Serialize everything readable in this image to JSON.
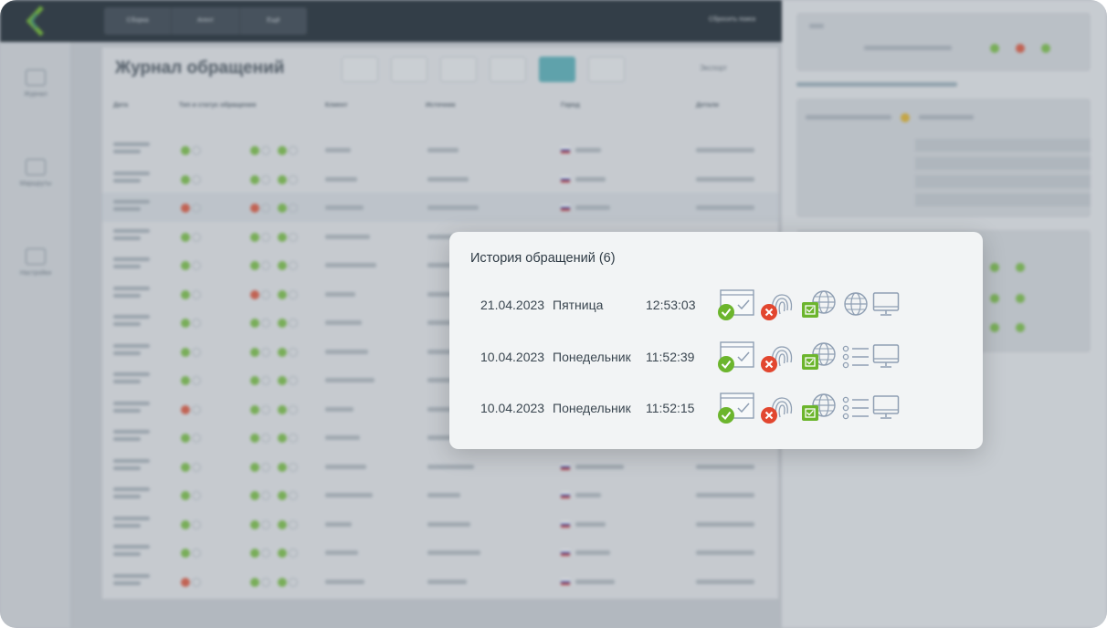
{
  "app": {
    "top_segments": [
      "Сборка",
      "Агент",
      "Ещё"
    ],
    "user": "Сбросить поиск",
    "sidebar": [
      {
        "label": "Журнал",
        "icon": "journal-icon"
      },
      {
        "label": "Маршруты",
        "icon": "routes-icon"
      },
      {
        "label": "Настройки",
        "icon": "settings-icon"
      }
    ],
    "page_title": "Журнал обращений",
    "export_label": "Экспорт",
    "columns": [
      "Дата",
      "Тип и статус обращения",
      "Клиент",
      "Источник",
      "Город",
      "Детали"
    ]
  },
  "modal": {
    "title": "История обращений (6)",
    "rows": [
      {
        "date": "21.04.2023",
        "day": "Пятница",
        "time": "12:53:03",
        "form_status": "success",
        "fingerprint_status": "error",
        "network_status": "success",
        "extra_icon": "globe-icon",
        "device_icon": "monitor-icon"
      },
      {
        "date": "10.04.2023",
        "day": "Понедельник",
        "time": "11:52:39",
        "form_status": "success",
        "fingerprint_status": "error",
        "network_status": "success",
        "extra_icon": "list-icon",
        "device_icon": "monitor-icon"
      },
      {
        "date": "10.04.2023",
        "day": "Понедельник",
        "time": "11:52:15",
        "form_status": "success",
        "fingerprint_status": "error",
        "network_status": "success",
        "extra_icon": "list-icon",
        "device_icon": "monitor-icon"
      }
    ]
  },
  "colors": {
    "success": "#6cb52d",
    "error": "#e2462f",
    "icon_line": "#8f9fb3",
    "topbar": "#1f2b34",
    "accent": "#5ab0b8"
  }
}
